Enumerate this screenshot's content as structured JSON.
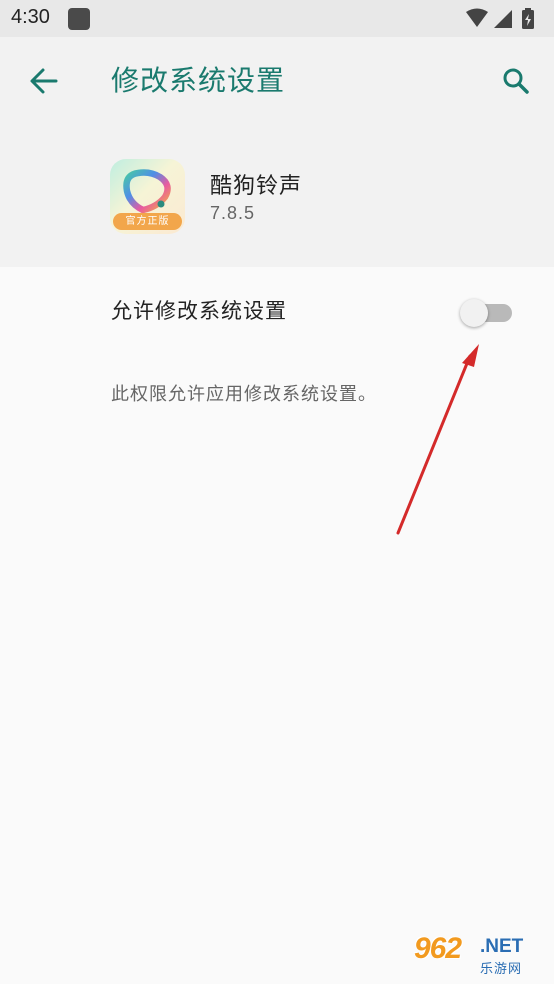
{
  "status_bar": {
    "time": "4:30",
    "icons": [
      "notification-icon",
      "wifi-icon",
      "cell-signal-icon",
      "battery-charging-icon"
    ]
  },
  "header": {
    "title": "修改系统设置",
    "back_icon": "arrow-left-icon",
    "search_icon": "search-icon",
    "accent_color": "#1a7a6e"
  },
  "app": {
    "name": "酷狗铃声",
    "version": "7.8.5",
    "icon_badge": "官方正版"
  },
  "setting": {
    "label": "允许修改系统设置",
    "enabled": false,
    "summary": "此权限允许应用修改系统设置。"
  },
  "annotation": {
    "arrow_color": "#d42a2a"
  },
  "watermark": {
    "brand": "962",
    "domain": ".NET",
    "subtitle": "乐游网"
  }
}
